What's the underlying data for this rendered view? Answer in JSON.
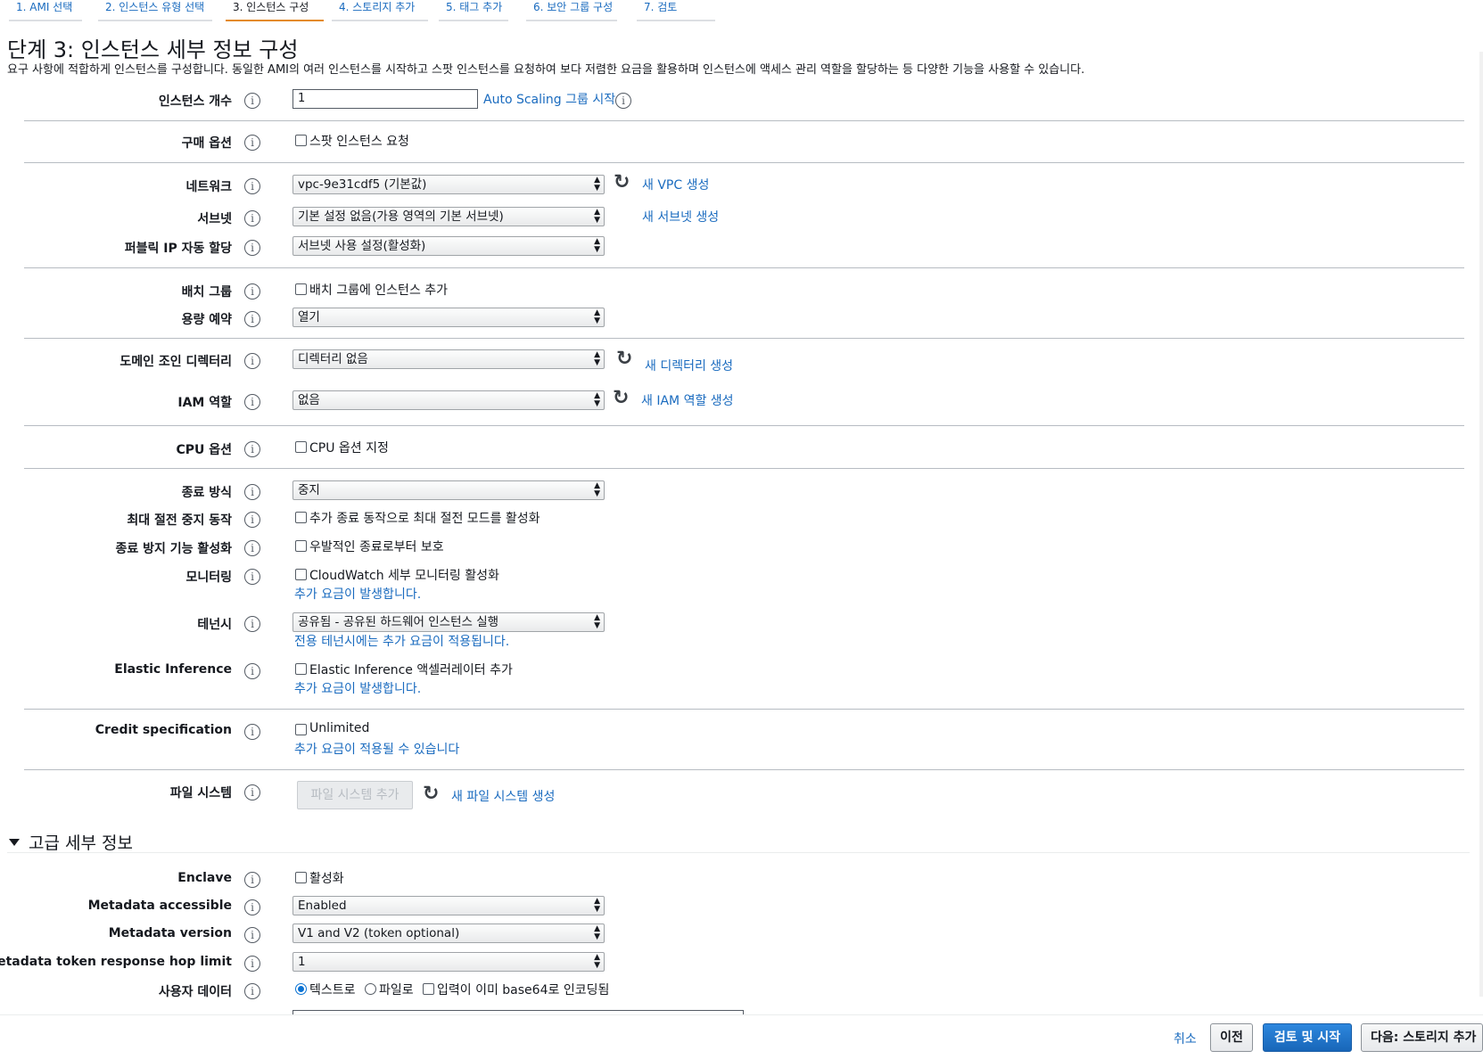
{
  "tabs": [
    "1. AMI 선택",
    "2. 인스턴스 유형 선택",
    "3. 인스턴스 구성",
    "4. 스토리지 추가",
    "5. 태그 추가",
    "6. 보안 그룹 구성",
    "7. 검토"
  ],
  "page": {
    "title": "단계 3: 인스턴스 세부 정보 구성",
    "description": "요구 사항에 적합하게 인스턴스를 구성합니다. 동일한 AMI의 여러 인스턴스를 시작하고 스팟 인스턴스를 요청하여 보다 저렴한 요금을 활용하며 인스턴스에 액세스 관리 역할을 할당하는 등 다양한 기능을 사용할 수 있습니다."
  },
  "info_glyph": "i",
  "fields": {
    "instance_count": {
      "label": "인스턴스 개수",
      "value": "1",
      "link": "Auto Scaling 그룹 시작"
    },
    "purchase": {
      "label": "구매 옵션",
      "checkbox": "스팟 인스턴스 요청"
    },
    "network": {
      "label": "네트워크",
      "value": "vpc-9e31cdf5 (기본값)",
      "link": "새 VPC 생성"
    },
    "subnet": {
      "label": "서브넷",
      "value": "기본 설정 없음(가용 영역의 기본 서브넷)",
      "link": "새 서브넷 생성"
    },
    "public_ip": {
      "label": "퍼블릭 IP 자동 할당",
      "value": "서브넷 사용 설정(활성화)"
    },
    "placement": {
      "label": "배치 그룹",
      "checkbox": "배치 그룹에 인스턴스 추가"
    },
    "capacity": {
      "label": "용량 예약",
      "value": "열기"
    },
    "domain": {
      "label": "도메인 조인 디렉터리",
      "value": "디렉터리 없음",
      "link": "새 디렉터리 생성"
    },
    "iam": {
      "label": "IAM 역할",
      "value": "없음",
      "link": "새 IAM 역할 생성"
    },
    "cpu": {
      "label": "CPU 옵션",
      "checkbox": "CPU 옵션 지정"
    },
    "shutdown": {
      "label": "종료 방식",
      "value": "중지"
    },
    "hibernate": {
      "label": "최대 절전 중지 동작",
      "checkbox": "추가 종료 동작으로 최대 절전 모드를 활성화"
    },
    "termination": {
      "label": "종료 방지 기능 활성화",
      "checkbox": "우발적인 종료로부터 보호"
    },
    "monitoring": {
      "label": "모니터링",
      "checkbox": "CloudWatch 세부 모니터링 활성화",
      "note": "추가 요금이 발생합니다."
    },
    "tenancy": {
      "label": "테넌시",
      "value": "공유됨 - 공유된 하드웨어 인스턴스 실행",
      "note": "전용 테넌시에는 추가 요금이 적용됩니다."
    },
    "elastic": {
      "label": "Elastic Inference",
      "checkbox": "Elastic Inference 액셀러레이터 추가",
      "note": "추가 요금이 발생합니다."
    },
    "credit": {
      "label": "Credit specification",
      "checkbox": "Unlimited",
      "note": "추가 요금이 적용될 수 있습니다"
    },
    "filesystem": {
      "label": "파일 시스템",
      "button": "파일 시스템 추가",
      "link": "새 파일 시스템 생성"
    }
  },
  "advanced": {
    "title": "고급 세부 정보",
    "enclave": {
      "label": "Enclave",
      "checkbox": "활성화"
    },
    "metadata_accessible": {
      "label": "Metadata accessible",
      "value": "Enabled"
    },
    "metadata_version": {
      "label": "Metadata version",
      "value": "V1 and V2 (token optional)"
    },
    "hop_limit": {
      "label": "Metadata token response hop limit",
      "value": "1"
    },
    "user_data": {
      "label": "사용자 데이터",
      "radio_text": "텍스트로",
      "radio_file": "파일로",
      "checkbox": "입력이 이미 base64로 인코딩됨"
    }
  },
  "footer": {
    "cancel": "취소",
    "previous": "이전",
    "review": "검토 및 시작",
    "next": "다음: 스토리지 추가"
  },
  "colors": {
    "link": "#1a6bbf",
    "primary": "#1866b8",
    "active_tab": "#e48a20"
  }
}
